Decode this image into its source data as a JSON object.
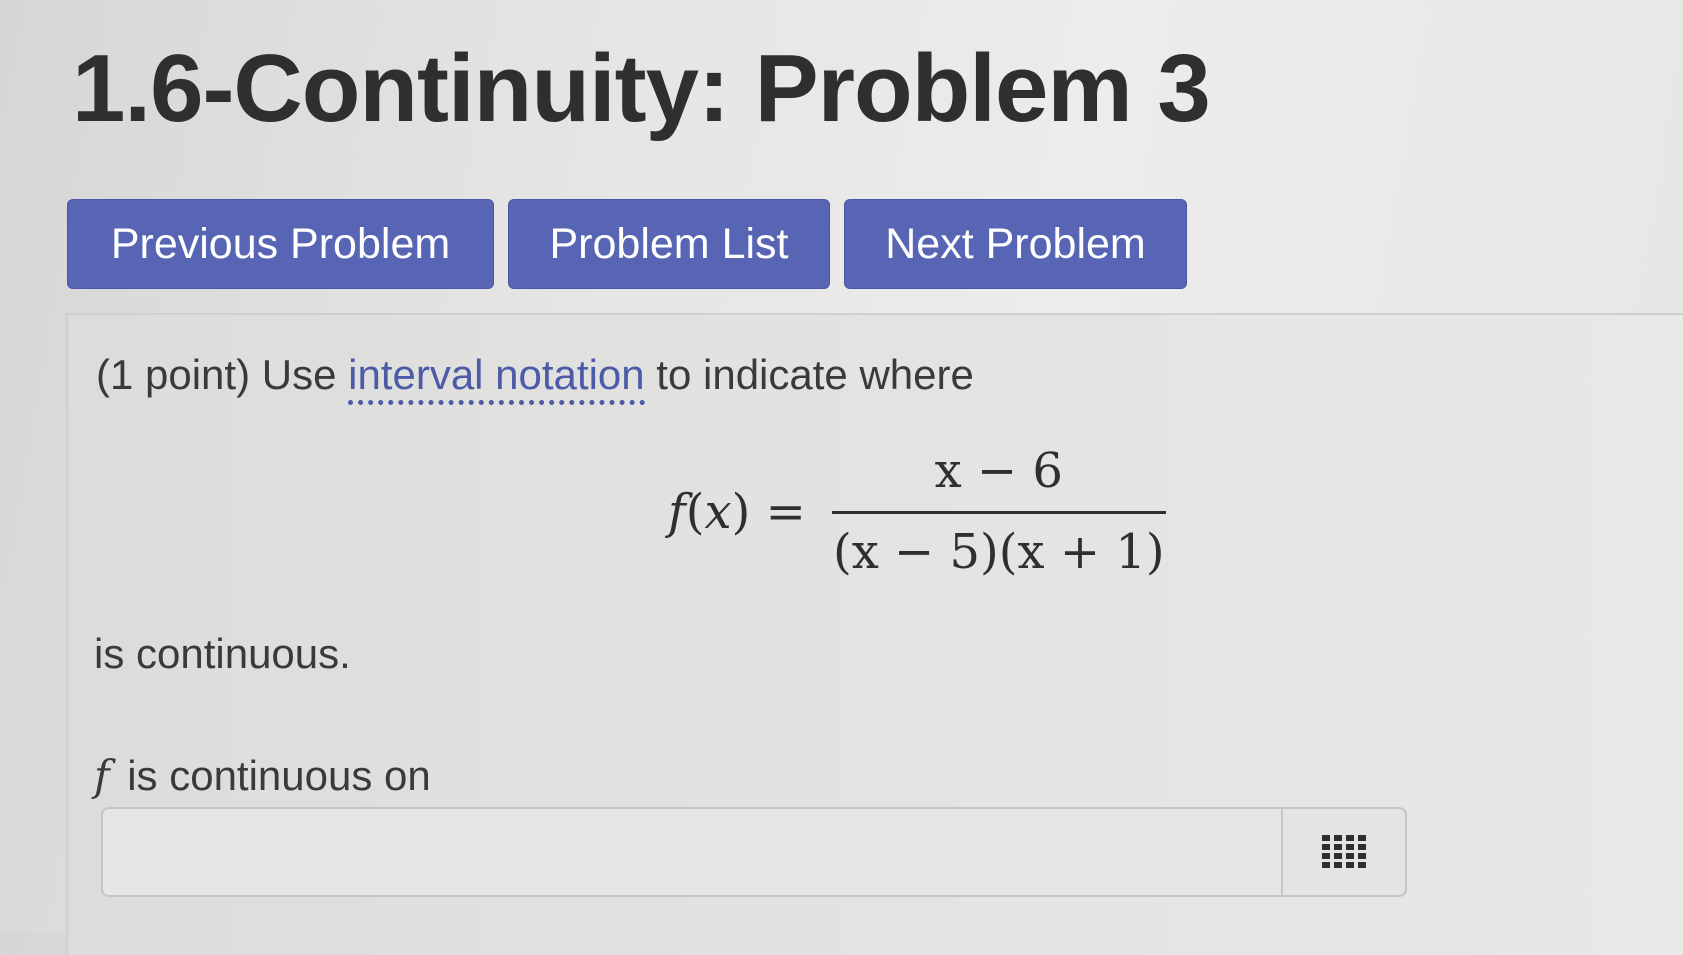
{
  "page": {
    "title": "1.6-Continuity: Problem 3"
  },
  "nav": {
    "previous_label": "Previous Problem",
    "list_label": "Problem List",
    "next_label": "Next Problem",
    "button_color": "#5765b4"
  },
  "problem": {
    "intro_prefix": "(1 point) Use ",
    "intro_link": "interval notation",
    "intro_suffix": " to indicate where",
    "formula": {
      "lhs_func": "f",
      "lhs_arg": "x",
      "numerator": "x − 6",
      "denominator": "(x − 5)(x + 1)"
    },
    "continuous_text": "is continuous.",
    "answer_var": "f",
    "answer_label": "is continuous on",
    "answer_value": "",
    "palette_icon": "grid-palette-icon"
  }
}
